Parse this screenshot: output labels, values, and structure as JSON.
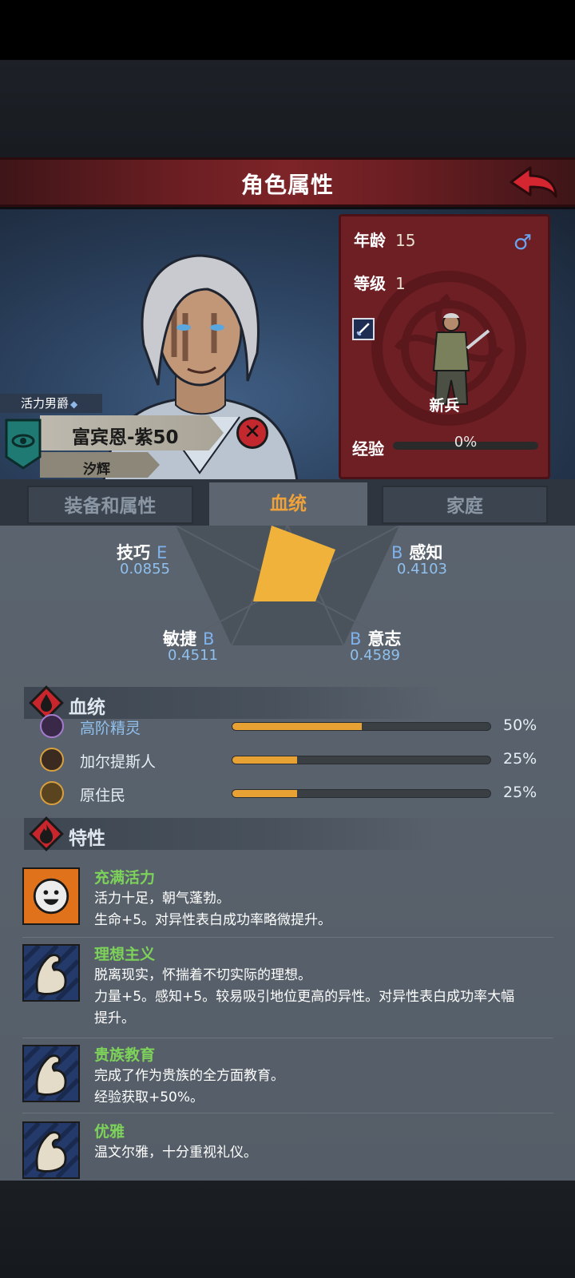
{
  "header": {
    "title": "角色属性"
  },
  "character": {
    "title_badge": "活力男爵",
    "name": "富宾恩-紫50",
    "family_name": "汐辉",
    "age_label": "年龄",
    "age": "15",
    "level_label": "等级",
    "level": "1",
    "gender_symbol": "♂",
    "class_name": "新兵",
    "exp_label": "经验",
    "exp_text": "0%",
    "exp_fraction": 0.0,
    "remove_symbol": "✕"
  },
  "tabs": [
    {
      "label": "装备和属性",
      "active": false
    },
    {
      "label": "血统",
      "active": true
    },
    {
      "label": "家庭",
      "active": false
    }
  ],
  "stats": {
    "skill": {
      "label": "技巧",
      "grade": "E",
      "value": "0.0855"
    },
    "perception": {
      "label": "感知",
      "grade": "B",
      "value": "0.4103"
    },
    "agility": {
      "label": "敏捷",
      "grade": "B",
      "value": "0.4511"
    },
    "will": {
      "label": "意志",
      "grade": "B",
      "value": "0.4589"
    }
  },
  "lineage": {
    "header": "血统",
    "items": [
      {
        "name": "高阶精灵",
        "percent_text": "50%",
        "fraction": 0.5,
        "icon": "elf-icon"
      },
      {
        "name": "加尔提斯人",
        "percent_text": "25%",
        "fraction": 0.25,
        "icon": "beast-icon"
      },
      {
        "name": "原住民",
        "percent_text": "25%",
        "fraction": 0.25,
        "icon": "leaf-icon"
      }
    ]
  },
  "traits": {
    "header": "特性",
    "items": [
      {
        "name": "充满活力",
        "lines": [
          "活力十足，朝气蓬勃。",
          "生命+5。对异性表白成功率略微提升。"
        ],
        "icon": "smiley-icon"
      },
      {
        "name": "理想主义",
        "lines": [
          "脱离现实，怀揣着不切实际的理想。",
          "力量+5。感知+5。较易吸引地位更高的异性。对异性表白成功率大幅",
          "提升。"
        ],
        "icon": "flex-arm-icon"
      },
      {
        "name": "贵族教育",
        "lines": [
          "完成了作为贵族的全方面教育。",
          "经验获取+50%。"
        ],
        "icon": "flex-arm-icon"
      },
      {
        "name": "优雅",
        "lines": [
          "温文尔雅，十分重视礼仪。"
        ],
        "icon": "flex-arm-icon"
      }
    ]
  },
  "colors": {
    "accent": "#f0a23a",
    "bar_fill": "#e8a233",
    "trait_name": "#7dd35a",
    "header_red": "#7d2428"
  }
}
